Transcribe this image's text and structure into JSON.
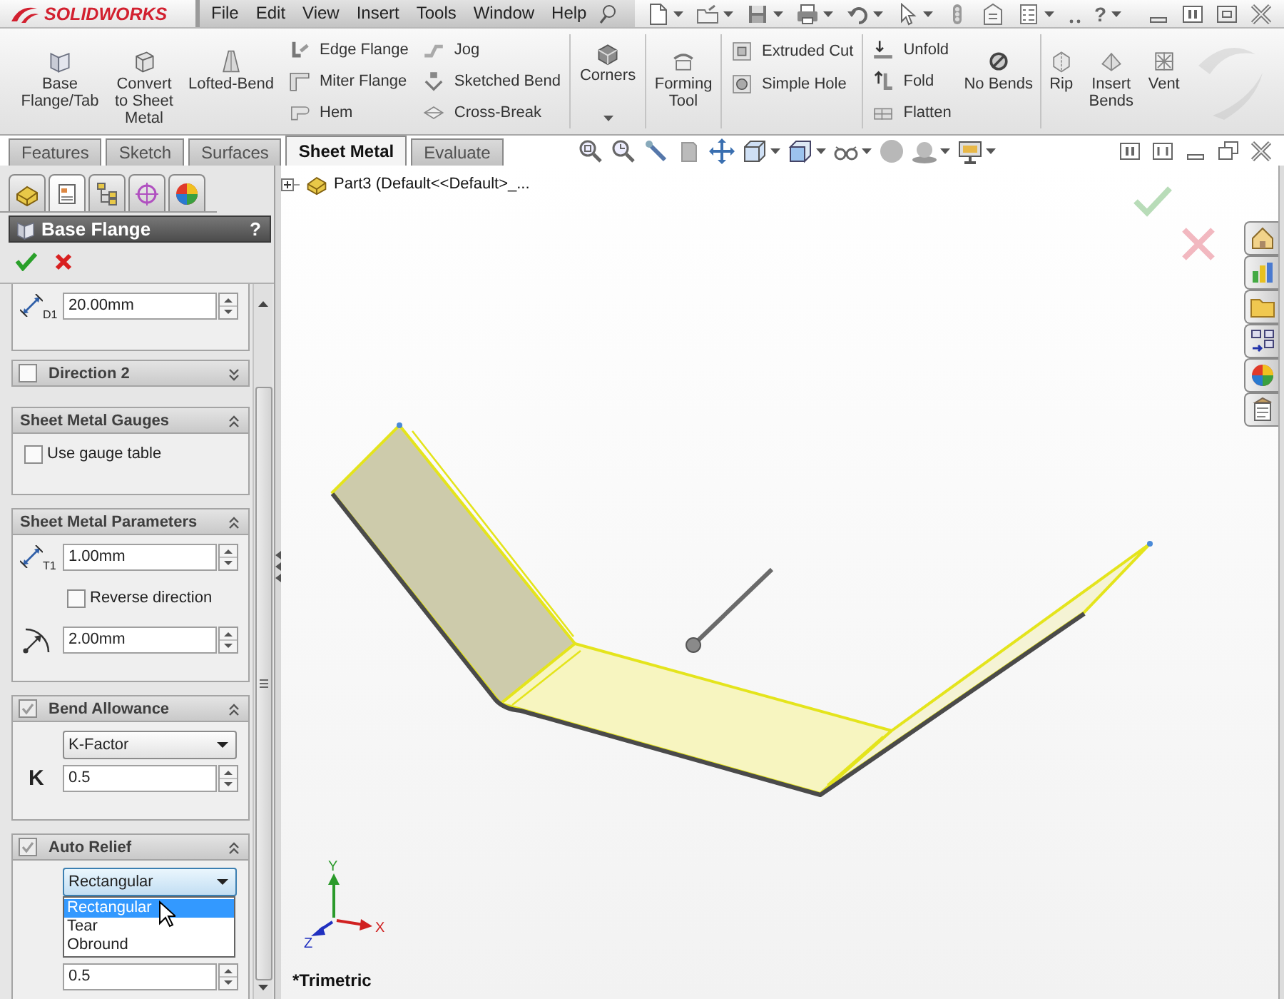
{
  "title_bar": {
    "product": "SOLIDWORKS",
    "menus": [
      "File",
      "Edit",
      "View",
      "Insert",
      "Tools",
      "Window",
      "Help"
    ],
    "help_label": "?"
  },
  "ribbon": {
    "sections": [
      {
        "columns": [
          {
            "kind": "large",
            "label": "Base Flange/Tab"
          },
          {
            "kind": "large",
            "label": "Convert to Sheet Metal"
          },
          {
            "kind": "large",
            "label": "Lofted-Bend"
          },
          {
            "kind": "stack",
            "items": [
              "Edge Flange",
              "Miter Flange",
              "Hem"
            ]
          },
          {
            "kind": "stack",
            "items": [
              "Jog",
              "Sketched Bend",
              "Cross-Break"
            ]
          }
        ]
      },
      {
        "columns": [
          {
            "kind": "large",
            "label": "Corners",
            "dropdown": true
          }
        ]
      },
      {
        "columns": [
          {
            "kind": "large",
            "label": "Forming Tool"
          }
        ]
      },
      {
        "columns": [
          {
            "kind": "stack",
            "items": [
              "Extruded Cut",
              "Simple Hole"
            ]
          }
        ]
      },
      {
        "columns": [
          {
            "kind": "stack",
            "items": [
              "Unfold",
              "Fold",
              "Flatten"
            ]
          },
          {
            "kind": "large",
            "label": "No Bends"
          }
        ]
      },
      {
        "columns": [
          {
            "kind": "large",
            "label": "Rip"
          },
          {
            "kind": "large",
            "label": "Insert Bends"
          },
          {
            "kind": "large",
            "label": "Vent"
          }
        ]
      }
    ]
  },
  "command_tabs": [
    {
      "label": "Features",
      "selected": false
    },
    {
      "label": "Sketch",
      "selected": false
    },
    {
      "label": "Surfaces",
      "selected": false
    },
    {
      "label": "Sheet Metal",
      "selected": true
    },
    {
      "label": "Evaluate",
      "selected": false
    }
  ],
  "property_manager": {
    "tabs": [
      {
        "selected": false
      },
      {
        "selected": true
      },
      {
        "selected": false
      },
      {
        "selected": false
      },
      {
        "selected": false
      }
    ],
    "title": "Base Flange",
    "help": "?",
    "groups": [
      {
        "rows": [
          {
            "kind": "dimension",
            "symbol": "D1",
            "value": "20.00mm"
          }
        ]
      },
      {
        "title": "Direction 2",
        "checked": false,
        "expanded": false
      },
      {
        "title": "Sheet Metal Gauges",
        "expanded": true,
        "rows": [
          {
            "kind": "checkbox",
            "label": "Use gauge table",
            "checked": false
          }
        ]
      },
      {
        "title": "Sheet Metal Parameters",
        "expanded": true,
        "rows": [
          {
            "kind": "dimension",
            "symbol": "T1",
            "value": "1.00mm"
          },
          {
            "kind": "checkbox",
            "label": "Reverse direction",
            "checked": false
          },
          {
            "kind": "radius",
            "value": "2.00mm"
          }
        ]
      },
      {
        "title": "Bend Allowance",
        "checked": true,
        "expanded": true,
        "rows": [
          {
            "kind": "select",
            "value": "K-Factor",
            "open": false
          },
          {
            "kind": "factor",
            "symbol": "K",
            "value": "0.5"
          }
        ]
      },
      {
        "title": "Auto Relief",
        "checked": true,
        "expanded": true,
        "rows": [
          {
            "kind": "select",
            "value": "Rectangular",
            "open": true,
            "options": [
              {
                "label": "Rectangular",
                "selected": true
              },
              {
                "label": "Tear",
                "selected": false
              },
              {
                "label": "Obround",
                "selected": false
              }
            ]
          },
          {
            "kind": "spin",
            "value": "0.5"
          }
        ]
      }
    ]
  },
  "viewport": {
    "tree_item": "Part3 (Default<<Default>_...",
    "triad": {
      "y_label": "Y",
      "x_label": "X",
      "z_label": "Z"
    },
    "view_name": "*Trimetric"
  }
}
